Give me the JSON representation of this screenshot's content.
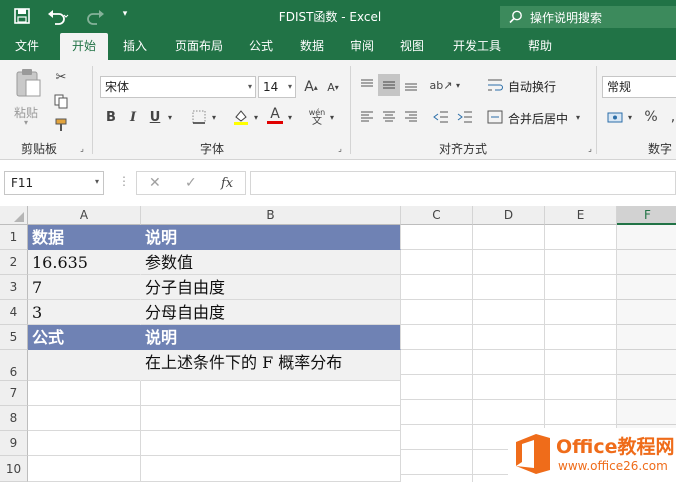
{
  "titlebar": {
    "title": "FDIST函数 - Excel",
    "search_placeholder": "操作说明搜索"
  },
  "tabs": [
    "文件",
    "开始",
    "插入",
    "页面布局",
    "公式",
    "数据",
    "审阅",
    "视图",
    "开发工具",
    "帮助"
  ],
  "active_tab": "开始",
  "ribbon": {
    "clipboard": {
      "paste": "粘贴",
      "label": "剪贴板"
    },
    "font": {
      "name": "宋体",
      "size": "14",
      "label": "字体",
      "bold": "B",
      "italic": "I",
      "underline": "U",
      "font_color_letter": "A",
      "phonetic": "wén"
    },
    "alignment": {
      "wrap": "自动换行",
      "merge": "合并后居中",
      "label": "对齐方式"
    },
    "number": {
      "format": "常规",
      "label": "数字",
      "percent": "%"
    }
  },
  "formula_bar": {
    "name_box": "F11",
    "fx": "fx",
    "value": ""
  },
  "columns": [
    "A",
    "B",
    "C",
    "D",
    "E",
    "F"
  ],
  "selected_column": "F",
  "rows": [
    {
      "num": "1",
      "a": "数据",
      "b": "说明",
      "style": "header"
    },
    {
      "num": "2",
      "a": "16.635",
      "b": "参数值",
      "style": "grey"
    },
    {
      "num": "3",
      "a": "7",
      "b": "分子自由度",
      "style": "grey"
    },
    {
      "num": "4",
      "a": "3",
      "b": "分母自由度",
      "style": "grey"
    },
    {
      "num": "5",
      "a": "公式",
      "b": "说明",
      "style": "header"
    },
    {
      "num": "6",
      "a": "",
      "b": "在上述条件下的 F 概率分布",
      "style": "grey"
    },
    {
      "num": "7",
      "a": "",
      "b": "",
      "style": "plain"
    },
    {
      "num": "8",
      "a": "",
      "b": "",
      "style": "plain"
    },
    {
      "num": "9",
      "a": "",
      "b": "",
      "style": "plain"
    },
    {
      "num": "10",
      "a": "",
      "b": "",
      "style": "plain"
    }
  ],
  "watermark": {
    "brand": "Office教程网",
    "url": "www.office26.com"
  },
  "colors": {
    "excel_green": "#217346",
    "header_fill": "#6f82b4",
    "grey_fill": "#f1f1f1",
    "watermark_orange": "#ef6c1a"
  }
}
